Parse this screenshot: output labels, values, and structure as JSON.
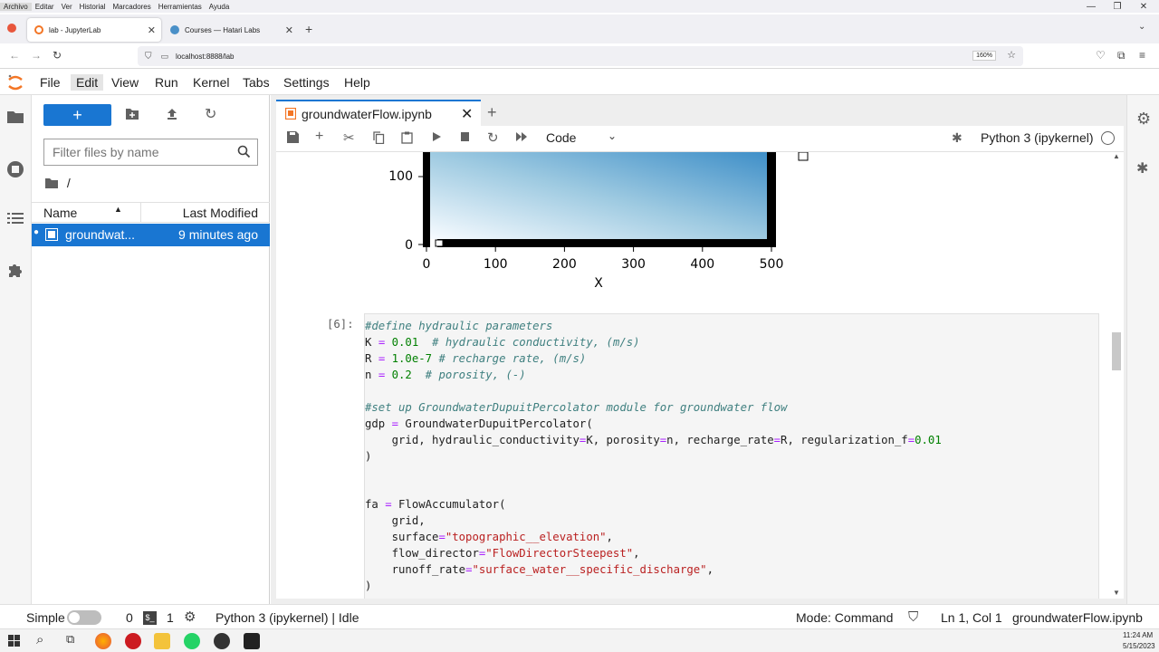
{
  "firefox": {
    "menu": [
      "Archivo",
      "Editar",
      "Ver",
      "Historial",
      "Marcadores",
      "Herramientas",
      "Ayuda"
    ],
    "tabs": [
      {
        "title": "lab - JupyterLab"
      },
      {
        "title": "Courses — Hatari Labs"
      }
    ],
    "url": "localhost:8888/lab",
    "zoom": "160%"
  },
  "jupyter": {
    "menu": [
      "File",
      "Edit",
      "View",
      "Run",
      "Kernel",
      "Tabs",
      "Settings",
      "Help"
    ],
    "filebrowser": {
      "new_label": "+",
      "filter_placeholder": "Filter files by name",
      "breadcrumb": "/",
      "col_name": "Name",
      "col_modified": "Last Modified",
      "files": [
        {
          "name": "groundwat...",
          "modified": "9 minutes ago"
        }
      ]
    },
    "notebook": {
      "tab_title": "groundwaterFlow.ipynb",
      "cell_type": "Code",
      "kernel": "Python 3 (ipykernel)",
      "plot": {
        "y_ticks": [
          "100",
          "0"
        ],
        "x_ticks": [
          "0",
          "100",
          "200",
          "300",
          "400",
          "500"
        ],
        "xlabel": "X"
      },
      "cell_prompt": "[6]:",
      "code_lines": [
        "#define hydraulic parameters",
        "K = 0.01  # hydraulic conductivity, (m/s)",
        "R = 1.0e-7 # recharge rate, (m/s)",
        "n = 0.2  # porosity, (-)",
        "",
        "#set up GroundwaterDupuitPercolator module for groundwater flow",
        "gdp = GroundwaterDupuitPercolator(",
        "    grid, hydraulic_conductivity=K, porosity=n, recharge_rate=R, regularization_f=0.01",
        ")",
        "",
        "",
        "fa = FlowAccumulator(",
        "    grid,",
        "    surface=\"topographic__elevation\",",
        "    flow_director=\"FlowDirectorSteepest\",",
        "    runoff_rate=\"surface_water__specific_discharge\",",
        ")"
      ]
    },
    "status": {
      "mode_label": "Simple",
      "terminals": "0",
      "kernels": "1",
      "kernel_status": "Python 3 (ipykernel) | Idle",
      "mode": "Mode: Command",
      "cursor": "Ln 1, Col 1",
      "file": "groundwaterFlow.ipynb"
    }
  },
  "taskbar": {
    "time": "11:24 AM",
    "date": "5/15/2023"
  }
}
